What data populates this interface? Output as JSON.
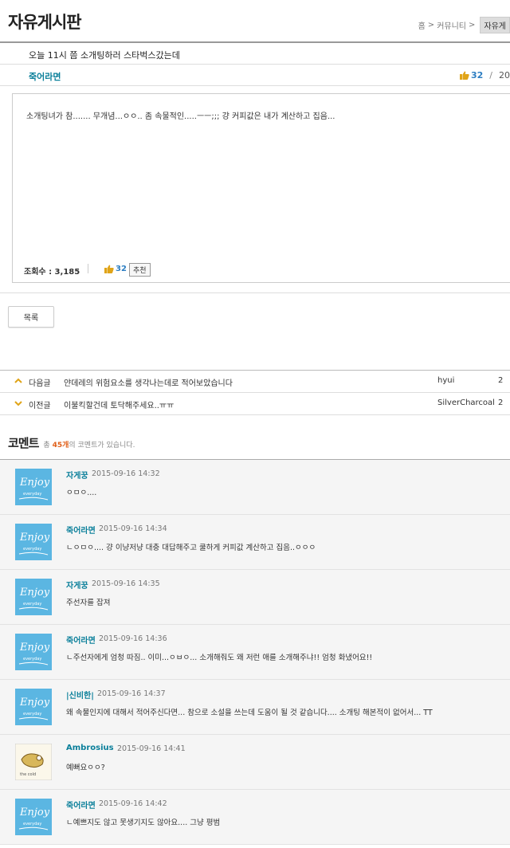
{
  "board_title": "자유게시판",
  "breadcrumb": {
    "home": "홈",
    "sep": ">",
    "community": "커뮤니티",
    "current": "자유게"
  },
  "post": {
    "subject": "오늘 11시 쯤 소개팅하러 스타벅스갔는데",
    "author": "죽어라면",
    "likes": "32",
    "extra": "20",
    "body": "소개팅녀가 참....... 무개념...ㅇㅇ.. 좀 속물적인.....ㅡㅡ;;; 걍 커피값은 내가 계산하고 집음...",
    "views_label": "조회수 : 3,185",
    "likes_mid": "32",
    "recommend_label": "추천"
  },
  "list_button": "목록",
  "nav": [
    {
      "arrow": "^",
      "label": "다음글",
      "title": "얀데레의 위험요소를 생각나는데로 적어보았습니다",
      "user": "hyui",
      "extra": "2"
    },
    {
      "arrow": "v",
      "label": "이전글",
      "title": "이불킥할건데 토닥해주세요..ㅠㅠ",
      "user": "SilverCharcoal",
      "extra": "2"
    }
  ],
  "comments_header": {
    "title": "코멘트",
    "pre": "총",
    "count": "45개",
    "post": "의 코멘트가 있습니다."
  },
  "comments": [
    {
      "name": "자게꿍",
      "date": "2015-09-16 14:32",
      "text": "ㅇㅁㅇ....",
      "avatar": "enjoy"
    },
    {
      "name": "죽어라면",
      "date": "2015-09-16 14:34",
      "text": "ㄴㅇㅁㅇ.... 걍 이냥저냥 대충 대답해주고 쿨하게 커피값 계산하고 집음..ㅇㅇㅇ",
      "avatar": "enjoy"
    },
    {
      "name": "자게꿍",
      "date": "2015-09-16 14:35",
      "text": "주선자를 잡져",
      "avatar": "enjoy"
    },
    {
      "name": "죽어라면",
      "date": "2015-09-16 14:36",
      "text": "ㄴ주선자에게 엄청 따짐.. 이미...ㅇㅂㅇ... 소개해줘도 왜 저런 애를 소개해주냐!! 엄청 화냈어요!!",
      "avatar": "enjoy"
    },
    {
      "name": "|신비한|",
      "date": "2015-09-16 14:37",
      "text": "왜 속물인지에 대해서 적어주신다면... 참으로 소설을 쓰는데 도움이 될 것 같습니다.... 소개팅 해본적이 없어서... TT",
      "avatar": "enjoy"
    },
    {
      "name": "Ambrosius",
      "date": "2015-09-16 14:41",
      "text": "예뻐요ㅇㅇ?",
      "avatar": "sketch"
    },
    {
      "name": "죽어라면",
      "date": "2015-09-16 14:42",
      "text": "ㄴ예쁘지도 않고 못생기지도 않아요.... 그냥 평범",
      "avatar": "enjoy"
    }
  ],
  "colors": {
    "accent_teal": "#0a7f9a",
    "like_blue": "#2d7ec2",
    "count_orange": "#e0601a",
    "arrow_gold": "#e0a418"
  }
}
